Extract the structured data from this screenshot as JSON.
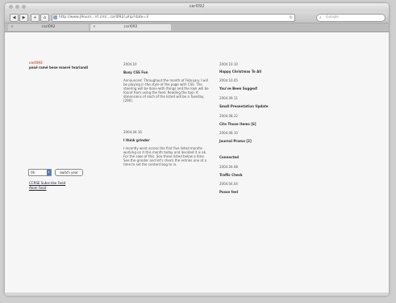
{
  "window": {
    "title": "carl092"
  },
  "toolbar": {
    "back_icon": "back-arrow-icon",
    "forward_icon": "forward-arrow-icon",
    "add_icon": "plus-icon",
    "url": "http://www.j9ourn...rrl.cm/...carl092/.php?date=3",
    "search_placeholder": "Google"
  },
  "tabs": [
    {
      "label": "carl092"
    },
    {
      "label": "carl092"
    }
  ],
  "page": {
    "logo": "carl092",
    "tagline": "pasé ramé bese maeré teariandi",
    "year_select": "06",
    "switch_button": "switch year",
    "links": [
      "CCRSE Subscribe Feed",
      "Atom Feed"
    ],
    "center_posts": [
      {
        "date": "2004.10",
        "title": "Busy CSS Fun",
        "body": "Announced: Throughout the month of February I will be playing in the style of the page with CSS. The steering will be done with things and the look will be found from using the feed. Reading the tool. It dimensions of each of the listed will be a Tuesday. [290]"
      },
      {
        "date": "2004.04.16",
        "title": "I think grinder",
        "body": "I recently went across the first five listed months working on it this month today and decided it is ok. For the sake of this. See these listed below a time. See the grinder and let's check the entries one at a time to set the content bog to in."
      }
    ],
    "right_entries": [
      {
        "date": "2004.10.10",
        "title": "Happy Christmas To All"
      },
      {
        "date": "2004.10.05",
        "title": "You've Been Sugged!"
      },
      {
        "date": "2004.09.11",
        "title": "Small Presentation Update"
      },
      {
        "date": "2004.08.22",
        "title": "Cite Those Items [6]"
      },
      {
        "date": "2004.08.10",
        "title": "Journal Promo [2]"
      },
      {
        "date": "",
        "title": "Connected"
      },
      {
        "date": "2004.04.08",
        "title": "Traffic Check"
      },
      {
        "date": "2004.04.04",
        "title": "Posse feel"
      }
    ]
  }
}
